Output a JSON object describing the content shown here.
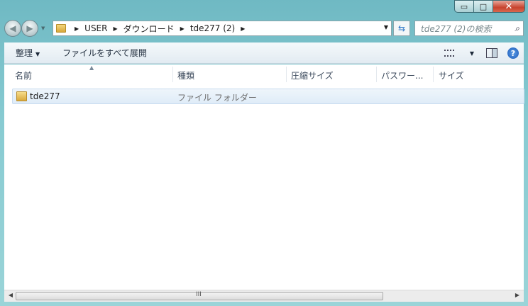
{
  "window": {
    "controls": {
      "minimize": "▭",
      "maximize": "□",
      "close": "✕"
    }
  },
  "nav": {
    "breadcrumbs": [
      "USER",
      "ダウンロード",
      "tde277 (2)"
    ],
    "search_placeholder": "tde277 (2)の検索"
  },
  "toolbar": {
    "organize_label": "整理",
    "extract_all_label": "ファイルをすべて展開"
  },
  "columns": [
    "名前",
    "種類",
    "圧縮サイズ",
    "パスワー...",
    "サイズ"
  ],
  "files": [
    {
      "name": "tde277",
      "type": "ファイル フォルダー"
    }
  ],
  "scrollbar": {
    "grip": "III"
  },
  "colors": {
    "selection": "#dfecf8",
    "accent": "#2a74c6"
  }
}
